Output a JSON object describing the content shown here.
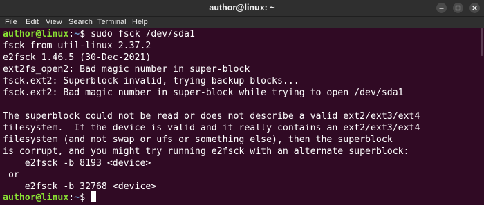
{
  "window": {
    "title": "author@linux: ~"
  },
  "menu": [
    "File",
    "Edit",
    "View",
    "Search",
    "Terminal",
    "Help"
  ],
  "prompt": {
    "user_host": "author@linux",
    "separator": ":",
    "path": "~",
    "symbol": "$"
  },
  "command": " sudo fsck /dev/sda1",
  "output": [
    "fsck from util-linux 2.37.2",
    "e2fsck 1.46.5 (30-Dec-2021)",
    "ext2fs_open2: Bad magic number in super-block",
    "fsck.ext2: Superblock invalid, trying backup blocks...",
    "fsck.ext2: Bad magic number in super-block while trying to open /dev/sda1",
    "",
    "The superblock could not be read or does not describe a valid ext2/ext3/ext4",
    "filesystem.  If the device is valid and it really contains an ext2/ext3/ext4",
    "filesystem (and not swap or ufs or something else), then the superblock",
    "is corrupt, and you might try running e2fsck with an alternate superblock:",
    "    e2fsck -b 8193 <device>",
    " or",
    "    e2fsck -b 32768 <device>"
  ],
  "colors": {
    "terminal_bg": "#300a24",
    "prompt_user": "#8ae234",
    "prompt_path": "#729fcf",
    "titlebar_bg": "#2f2f2f"
  },
  "icons": {
    "search": "search-icon",
    "hamburger": "hamburger-menu-icon",
    "minimize": "minimize-icon",
    "maximize": "maximize-icon",
    "close": "close-icon"
  }
}
